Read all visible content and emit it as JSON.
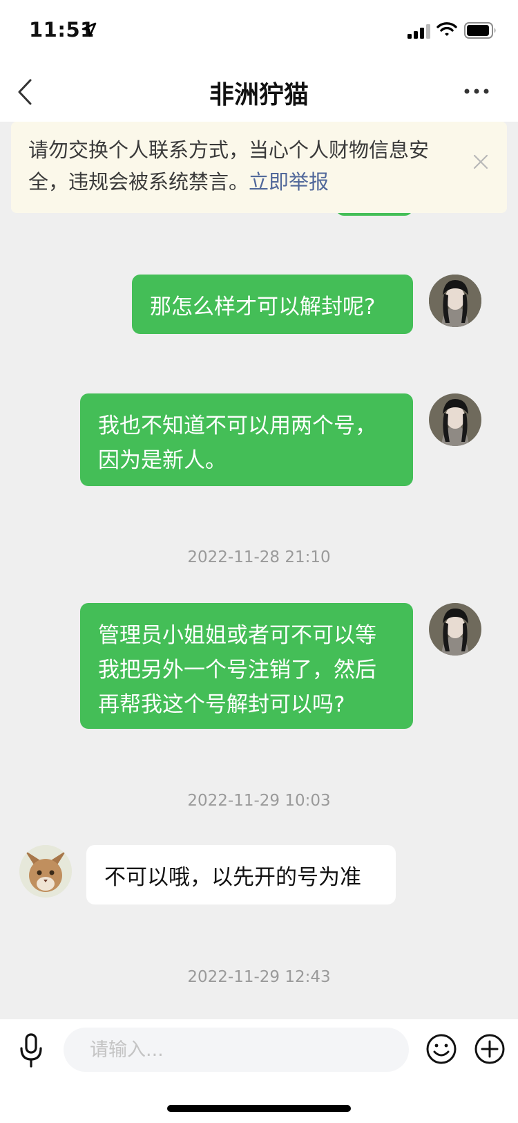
{
  "status_bar": {
    "time": "11:51"
  },
  "nav": {
    "title": "非洲狞猫"
  },
  "notice": {
    "text": "请勿交换个人联系方式，当心个人财物信息安全，违规会被系统禁言。",
    "link": "立即举报"
  },
  "messages": [
    {
      "sender": "me",
      "text": "那怎么样才可以解封呢?"
    },
    {
      "sender": "me",
      "text": "我也不知道不可以用两个号，因为是新人。"
    },
    {
      "type": "timestamp",
      "text": "2022-11-28 21:10"
    },
    {
      "sender": "me",
      "text": "管理员小姐姐或者可不可以等我把另外一个号注销了，然后再帮我这个号解封可以吗?"
    },
    {
      "type": "timestamp",
      "text": "2022-11-29 10:03"
    },
    {
      "sender": "them",
      "text": "不可以哦，以先开的号为准"
    },
    {
      "type": "timestamp",
      "text": "2022-11-29 12:43"
    }
  ],
  "input": {
    "placeholder": "请输入..."
  },
  "colors": {
    "my_bubble": "#44be57",
    "their_bubble": "#ffffff",
    "chat_bg": "#efefef",
    "notice_bg": "#fbf8ea",
    "link": "#51689a"
  },
  "icons": [
    "location-arrow-icon",
    "signal-icon",
    "wifi-icon",
    "battery-icon",
    "back-chevron-icon",
    "more-dots-icon",
    "close-icon",
    "microphone-icon",
    "emoji-icon",
    "plus-icon"
  ]
}
